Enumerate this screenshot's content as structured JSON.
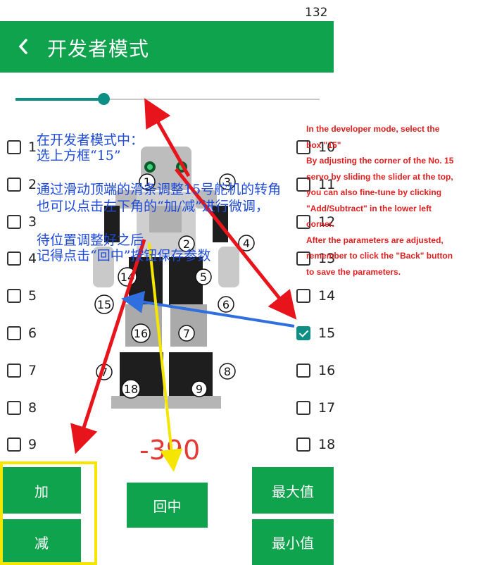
{
  "page_number": "132",
  "appbar": {
    "title": "开发者模式",
    "back_icon": "chevron-left-icon",
    "color": "#10a34d"
  },
  "slider": {
    "value_fraction": 0.29,
    "accent": "#0e8f86"
  },
  "checkboxes_left": [
    {
      "label": "1",
      "checked": false
    },
    {
      "label": "2",
      "checked": false
    },
    {
      "label": "3",
      "checked": false
    },
    {
      "label": "4",
      "checked": false
    },
    {
      "label": "5",
      "checked": false
    },
    {
      "label": "6",
      "checked": false
    },
    {
      "label": "7",
      "checked": false
    },
    {
      "label": "8",
      "checked": false
    },
    {
      "label": "9",
      "checked": false
    }
  ],
  "checkboxes_right": [
    {
      "label": "10",
      "checked": false
    },
    {
      "label": "11",
      "checked": false
    },
    {
      "label": "12",
      "checked": false
    },
    {
      "label": "13",
      "checked": false
    },
    {
      "label": "14",
      "checked": false
    },
    {
      "label": "15",
      "checked": true
    },
    {
      "label": "16",
      "checked": false
    },
    {
      "label": "17",
      "checked": false
    },
    {
      "label": "18",
      "checked": false
    }
  ],
  "robot_labels": [
    "1",
    "2",
    "3",
    "4",
    "14",
    "5",
    "15",
    "6",
    "16",
    "7",
    "8",
    "18",
    "9"
  ],
  "value_display": "-390",
  "buttons": {
    "add": "加",
    "subtract": "减",
    "center": "回中",
    "max": "最大值",
    "min": "最小值"
  },
  "annotation_cn": [
    "在开发者模式中：",
    "选上方框“15”",
    "通过滑动顶端的滑条调整15号舵机的转角",
    "也可以点击左下角的“加/减”进行微调，",
    "待位置调整好之后",
    "记得点击“回中”按钮保存参数"
  ],
  "annotation_en": [
    "In the developer mode, select the",
    "box \"15\"",
    "By adjusting the corner of the No. 15",
    "servo by sliding the slider at the top,",
    "you can also fine-tune by clicking",
    "\"Add/Subtract\" in the lower left",
    "corner.",
    "After the parameters are adjusted,",
    "remember to click the \"Back\" button",
    "to save the parameters."
  ],
  "colors": {
    "annotation_cn": "#1f4bd8",
    "annotation_en": "#e02020",
    "arrow_red": "#e8141c",
    "arrow_blue": "#2f6fe0",
    "arrow_yellow": "#f5e600",
    "highlight_box": "#f5e600"
  }
}
